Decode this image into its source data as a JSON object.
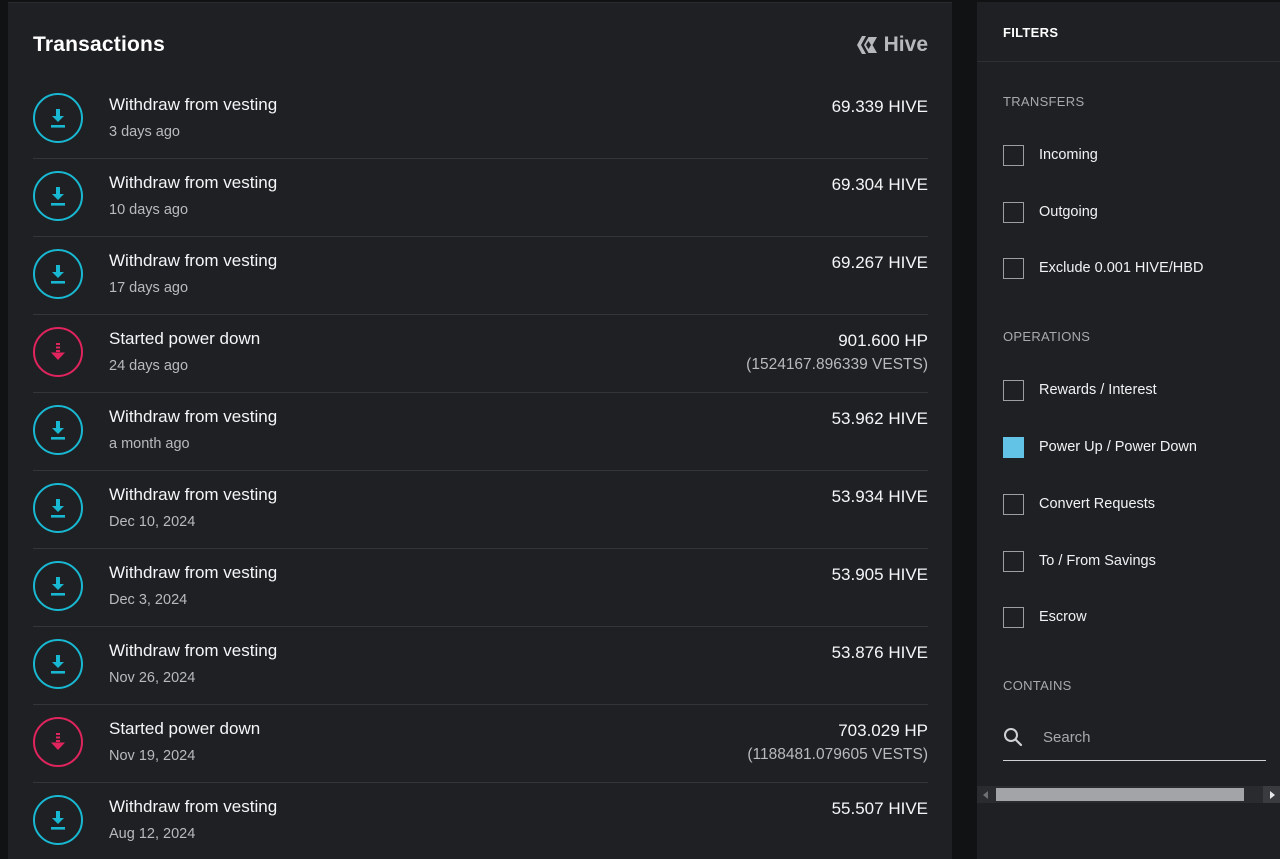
{
  "colors": {
    "withdraw_accent": "#19b8d2",
    "power_down_accent": "#e0245e",
    "checked_accent": "#63c3e6"
  },
  "transactions": {
    "title": "Transactions",
    "brand_name": "Hive",
    "rows": [
      {
        "type_icon": "download-icon",
        "kind": "withdraw",
        "name": "Withdraw from vesting",
        "time": "3 days ago",
        "amount": "69.339 HIVE",
        "sub": ""
      },
      {
        "type_icon": "download-icon",
        "kind": "withdraw",
        "name": "Withdraw from vesting",
        "time": "10 days ago",
        "amount": "69.304 HIVE",
        "sub": ""
      },
      {
        "type_icon": "download-icon",
        "kind": "withdraw",
        "name": "Withdraw from vesting",
        "time": "17 days ago",
        "amount": "69.267 HIVE",
        "sub": ""
      },
      {
        "type_icon": "power-down-icon",
        "kind": "powerdown",
        "name": "Started power down",
        "time": "24 days ago",
        "amount": "901.600 HP",
        "sub": "(1524167.896339 VESTS)"
      },
      {
        "type_icon": "download-icon",
        "kind": "withdraw",
        "name": "Withdraw from vesting",
        "time": "a month ago",
        "amount": "53.962 HIVE",
        "sub": ""
      },
      {
        "type_icon": "download-icon",
        "kind": "withdraw",
        "name": "Withdraw from vesting",
        "time": "Dec 10, 2024",
        "amount": "53.934 HIVE",
        "sub": ""
      },
      {
        "type_icon": "download-icon",
        "kind": "withdraw",
        "name": "Withdraw from vesting",
        "time": "Dec 3, 2024",
        "amount": "53.905 HIVE",
        "sub": ""
      },
      {
        "type_icon": "download-icon",
        "kind": "withdraw",
        "name": "Withdraw from vesting",
        "time": "Nov 26, 2024",
        "amount": "53.876 HIVE",
        "sub": ""
      },
      {
        "type_icon": "power-down-icon",
        "kind": "powerdown",
        "name": "Started power down",
        "time": "Nov 19, 2024",
        "amount": "703.029 HP",
        "sub": "(1188481.079605 VESTS)"
      },
      {
        "type_icon": "download-icon",
        "kind": "withdraw",
        "name": "Withdraw from vesting",
        "time": "Aug 12, 2024",
        "amount": "55.507 HIVE",
        "sub": ""
      }
    ]
  },
  "filters": {
    "title": "FILTERS",
    "transfers_label": "TRANSFERS",
    "transfers": [
      {
        "label": "Incoming",
        "checked": false
      },
      {
        "label": "Outgoing",
        "checked": false
      },
      {
        "label": "Exclude 0.001 HIVE/HBD",
        "checked": false
      }
    ],
    "operations_label": "OPERATIONS",
    "operations": [
      {
        "label": "Rewards / Interest",
        "checked": false
      },
      {
        "label": "Power Up / Power Down",
        "checked": true
      },
      {
        "label": "Convert Requests",
        "checked": false
      },
      {
        "label": "To / From Savings",
        "checked": false
      },
      {
        "label": "Escrow",
        "checked": false
      }
    ],
    "contains_label": "CONTAINS",
    "search_placeholder": "Search",
    "search_value": ""
  }
}
